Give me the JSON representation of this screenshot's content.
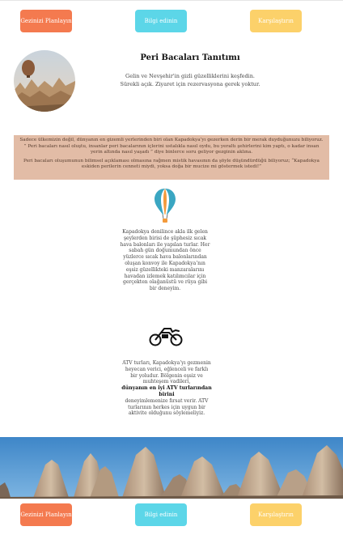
{
  "nav": {
    "plan_label": "Gezinizi Planlayın",
    "info_label": "Bilgi edinin",
    "compare_label": "Karşılaştırın"
  },
  "intro": {
    "title": "Peri Bacaları Tanıtımı",
    "line1": "Gelin ve Nevşehir'in gizli güzelliklerini keşfedin.",
    "line2": "Sürekli açık. Ziyaret için rezervasyona gerek yoktur."
  },
  "story": {
    "p1": "Sadece ülkemizin değil, dünyanın en gizemli yerlerinden biri olan Kapadokya’yı gezerken derin bir merak duyduğunuzu biliyoruz. ” Peri bacaları nasıl oluştu, insanlar peri bacalarının içlerini ustalıkla nasıl oydu, bu yeraltı şehirlerini kim yaptı, o kadar insan yerin altında nasıl yaşadı ” diye binlerce soru geliyor gezginin aklına.",
    "p2": "Peri bacaları oluşumunun bilimsel açıklaması olmasına rağmen mistik havasının da şöyle düşündürdüğü biliyoruz; “Kapadokya eskiden perilerin cenneti miydi, yoksa doğa bir mucize mi göstermek istedi!”"
  },
  "balloon_section": {
    "text": "Kapadokya denilince akla ilk gelen şeylerden birisi de şüphesiz sıcak hava balonları ile yapılan turlar. Her sabah gün doğumundan önce yüzlerce sıcak hava balonlarından oluşan konvoy ile Kapadokya’nın eşsiz güzellikteki manzaralarını havadan izlemek katılımcılar için gerçekten olağanüstü ve rüya gibi bir deneyim."
  },
  "atv_section": {
    "text_before": "ATV turları, Kapadokya’yı gezmenin heyecan verici, eğlenceli ve farklı bir yoludur. Bölgenin eşsiz ve muhteşem vadileri,",
    "text_bold": "dünyanın en iyi ATV turlarından birini",
    "text_after": "deneyimlemenize fırsat verir. ATV turlarının herkes için uygun bir aktivite olduğunu söylemeliyiz."
  },
  "colors": {
    "plan": "#f47a4f",
    "info": "#5cd6e8",
    "compare": "#fcd16a",
    "story_bg": "#e2bca6"
  },
  "icons": [
    "hot-air-balloon-icon",
    "motorcycle-icon"
  ]
}
